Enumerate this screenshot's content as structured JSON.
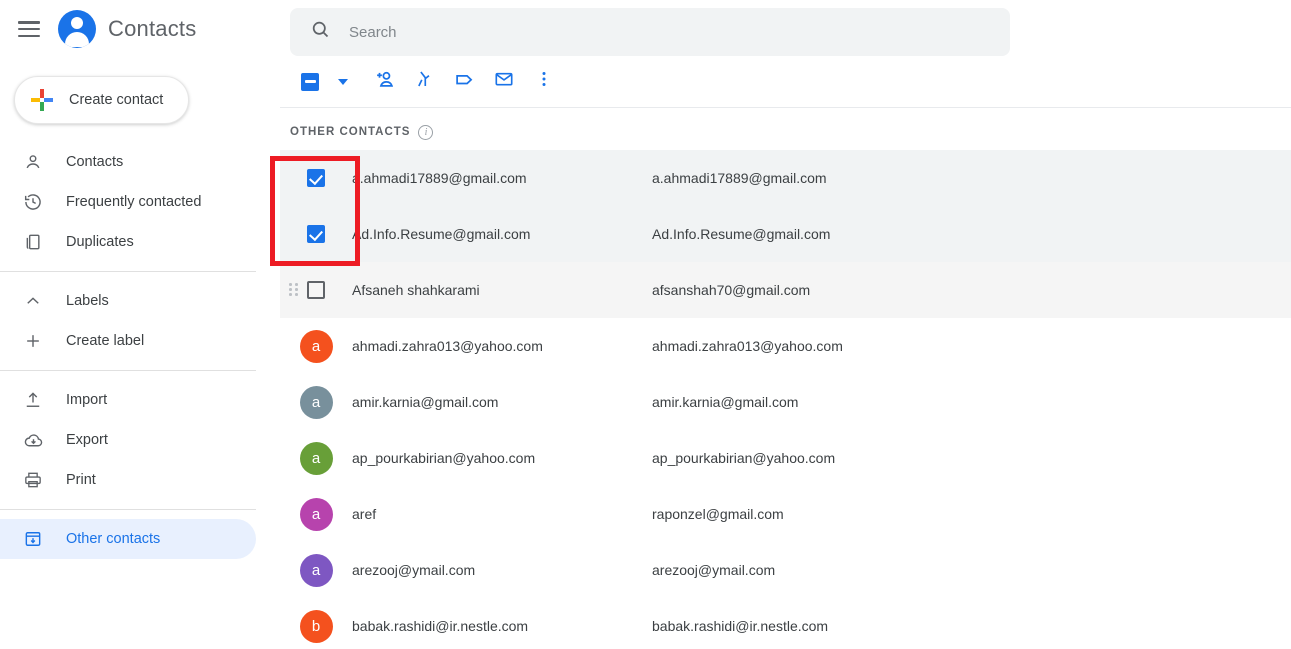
{
  "header": {
    "menu_icon": "hamburger-menu-icon",
    "app_logo_icon": "contacts-person-logo-icon",
    "app_title": "Contacts"
  },
  "create_button": {
    "label": "Create contact",
    "icon": "google-plus-icon"
  },
  "sidebar": {
    "items": [
      {
        "label": "Contacts",
        "icon": "person-outline-icon",
        "selected": false
      },
      {
        "label": "Frequently contacted",
        "icon": "history-clock-icon",
        "selected": false
      },
      {
        "label": "Duplicates",
        "icon": "duplicate-pages-icon",
        "selected": false
      },
      {
        "label": "Labels",
        "icon": "chevron-up-icon",
        "selected": false
      },
      {
        "label": "Create label",
        "icon": "plus-icon",
        "selected": false
      },
      {
        "label": "Import",
        "icon": "upload-icon",
        "selected": false
      },
      {
        "label": "Export",
        "icon": "cloud-download-icon",
        "selected": false
      },
      {
        "label": "Print",
        "icon": "printer-icon",
        "selected": false
      },
      {
        "label": "Other contacts",
        "icon": "archive-box-icon",
        "selected": true
      }
    ]
  },
  "search": {
    "placeholder": "Search",
    "value": "",
    "icon": "search-icon"
  },
  "toolbar": {
    "select_all_state": "indeterminate",
    "select_all_icon": "indeterminate-checkbox-icon",
    "dropdown_icon": "chevron-down-icon",
    "buttons": [
      {
        "name": "add-to-contacts-button",
        "icon": "person-add-icon"
      },
      {
        "name": "merge-button",
        "icon": "merge-icon"
      },
      {
        "name": "manage-labels-button",
        "icon": "label-tag-icon"
      },
      {
        "name": "send-email-button",
        "icon": "envelope-icon"
      },
      {
        "name": "more-options-button",
        "icon": "more-vertical-icon"
      }
    ]
  },
  "section": {
    "title": "OTHER CONTACTS",
    "info_icon": "info-circle-icon"
  },
  "colors": {
    "accent_blue": "#1a73e8",
    "selected_row_bg": "#f1f3f4",
    "hover_row_bg": "#f5f5f5",
    "annotation_red": "#ed1c24",
    "sidebar_selected_bg": "#e8f0fe"
  },
  "contacts": [
    {
      "lead_type": "checkbox",
      "checked": true,
      "name": "a.ahmadi17889@gmail.com",
      "email": "a.ahmadi17889@gmail.com",
      "row_state": "selected"
    },
    {
      "lead_type": "checkbox",
      "checked": true,
      "name": "Ad.Info.Resume@gmail.com",
      "email": "Ad.Info.Resume@gmail.com",
      "row_state": "selected"
    },
    {
      "lead_type": "checkbox-drag",
      "checked": false,
      "name": "Afsaneh shahkarami",
      "email": "afsanshah70@gmail.com",
      "row_state": "hover"
    },
    {
      "lead_type": "avatar",
      "avatar_letter": "a",
      "avatar_color": "#f4511e",
      "name": "ahmadi.zahra013@yahoo.com",
      "email": "ahmadi.zahra013@yahoo.com",
      "row_state": "none"
    },
    {
      "lead_type": "avatar",
      "avatar_letter": "a",
      "avatar_color": "#78909c",
      "name": "amir.karnia@gmail.com",
      "email": "amir.karnia@gmail.com",
      "row_state": "none"
    },
    {
      "lead_type": "avatar",
      "avatar_letter": "a",
      "avatar_color": "#689f38",
      "name": "ap_pourkabirian@yahoo.com",
      "email": "ap_pourkabirian@yahoo.com",
      "row_state": "none"
    },
    {
      "lead_type": "avatar",
      "avatar_letter": "a",
      "avatar_color": "#b743ad",
      "name": "aref",
      "email": "raponzel@gmail.com",
      "row_state": "none"
    },
    {
      "lead_type": "avatar",
      "avatar_letter": "a",
      "avatar_color": "#7e57c2",
      "name": "arezooj@ymail.com",
      "email": "arezooj@ymail.com",
      "row_state": "none"
    },
    {
      "lead_type": "avatar",
      "avatar_letter": "b",
      "avatar_color": "#f4511e",
      "name": "babak.rashidi@ir.nestle.com",
      "email": "babak.rashidi@ir.nestle.com",
      "row_state": "none"
    }
  ],
  "annotation": {
    "shape": "rectangle-highlight",
    "target": "selected-contacts-checkboxes"
  }
}
